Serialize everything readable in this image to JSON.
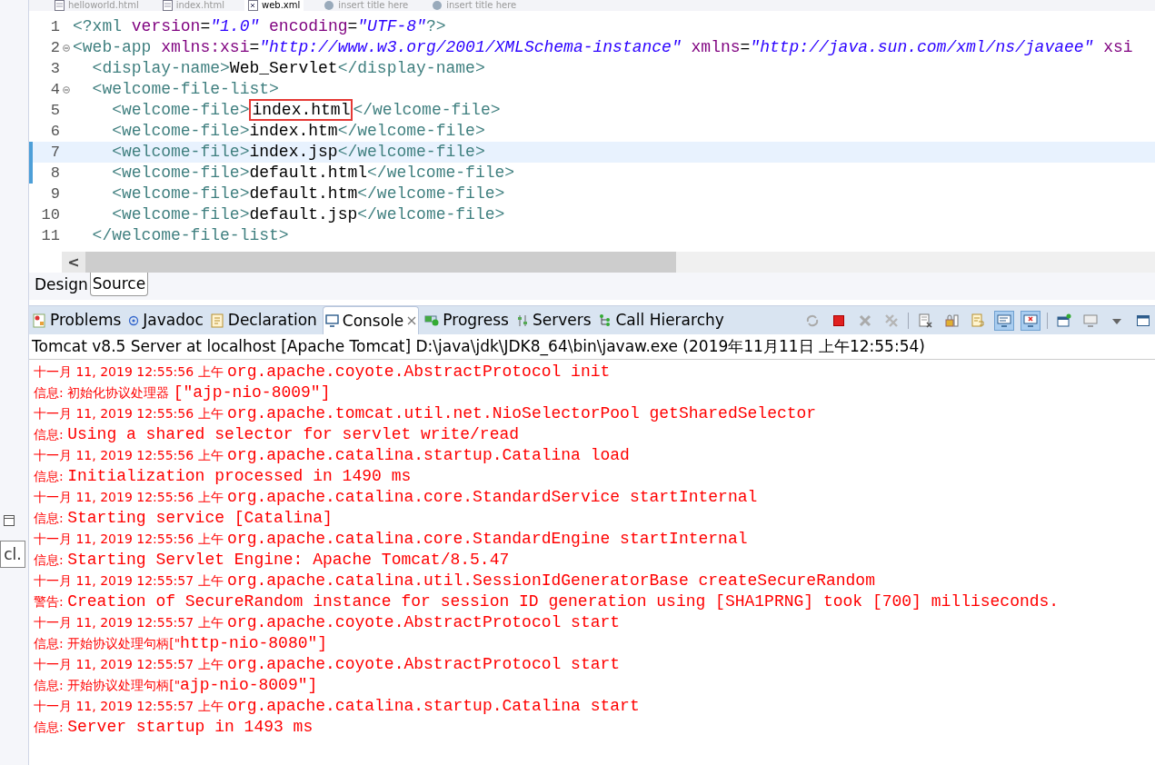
{
  "editor_tabs": [
    {
      "label": "helloworld.html",
      "selected": false,
      "kind": "html"
    },
    {
      "label": "index.html",
      "selected": false,
      "kind": "html"
    },
    {
      "label": "web.xml",
      "selected": true,
      "kind": "xml"
    },
    {
      "label": "insert title here",
      "selected": false,
      "kind": "web"
    },
    {
      "label": "insert title here",
      "selected": false,
      "kind": "web"
    }
  ],
  "code_lines": [
    {
      "number": "1",
      "foldable": false,
      "current": false,
      "changed": false,
      "tokens": [
        {
          "kind": "tag",
          "text": "<?xml "
        },
        {
          "kind": "attr",
          "text": "version"
        },
        {
          "kind": "punct",
          "text": "="
        },
        {
          "kind": "value",
          "text": "\"1.0\""
        },
        {
          "kind": "attr",
          "text": " encoding"
        },
        {
          "kind": "punct",
          "text": "="
        },
        {
          "kind": "value",
          "text": "\"UTF-8\""
        },
        {
          "kind": "tag",
          "text": "?>"
        }
      ]
    },
    {
      "number": "2",
      "foldable": true,
      "current": false,
      "changed": false,
      "tokens": [
        {
          "kind": "tag",
          "text": "<web-app "
        },
        {
          "kind": "attr",
          "text": "xmlns:xsi"
        },
        {
          "kind": "punct",
          "text": "="
        },
        {
          "kind": "value",
          "text": "\"http://www.w3.org/2001/XMLSchema-instance\""
        },
        {
          "kind": "attr",
          "text": " xmlns"
        },
        {
          "kind": "punct",
          "text": "="
        },
        {
          "kind": "value",
          "text": "\"http://java.sun.com/xml/ns/javaee\""
        },
        {
          "kind": "attr",
          "text": " xsi"
        }
      ]
    },
    {
      "number": "3",
      "foldable": false,
      "current": false,
      "changed": false,
      "tokens": [
        {
          "kind": "tag",
          "text": "  <display-name>"
        },
        {
          "kind": "text",
          "text": "Web_Servlet"
        },
        {
          "kind": "tag",
          "text": "</display-name>"
        }
      ]
    },
    {
      "number": "4",
      "foldable": true,
      "current": false,
      "changed": false,
      "tokens": [
        {
          "kind": "tag",
          "text": "  <welcome-file-list>"
        }
      ]
    },
    {
      "number": "5",
      "foldable": false,
      "current": false,
      "changed": false,
      "tokens": [
        {
          "kind": "tag",
          "text": "    <welcome-file>"
        },
        {
          "kind": "text",
          "text": "index.html",
          "boxed": true
        },
        {
          "kind": "tag",
          "text": "</welcome-file>"
        }
      ]
    },
    {
      "number": "6",
      "foldable": false,
      "current": false,
      "changed": false,
      "tokens": [
        {
          "kind": "tag",
          "text": "    <welcome-file>"
        },
        {
          "kind": "text",
          "text": "index.htm"
        },
        {
          "kind": "tag",
          "text": "</welcome-file>"
        }
      ]
    },
    {
      "number": "7",
      "foldable": false,
      "current": true,
      "changed": true,
      "tokens": [
        {
          "kind": "tag",
          "text": "    <welcome-file>"
        },
        {
          "kind": "text",
          "text": "index.jsp"
        },
        {
          "kind": "tag",
          "text": "</welcome-file>"
        }
      ]
    },
    {
      "number": "8",
      "foldable": false,
      "current": false,
      "changed": true,
      "tokens": [
        {
          "kind": "tag",
          "text": "    <welcome-file>"
        },
        {
          "kind": "text",
          "text": "default.html"
        },
        {
          "kind": "tag",
          "text": "</welcome-file>"
        }
      ]
    },
    {
      "number": "9",
      "foldable": false,
      "current": false,
      "changed": false,
      "tokens": [
        {
          "kind": "tag",
          "text": "    <welcome-file>"
        },
        {
          "kind": "text",
          "text": "default.htm"
        },
        {
          "kind": "tag",
          "text": "</welcome-file>"
        }
      ]
    },
    {
      "number": "10",
      "foldable": false,
      "current": false,
      "changed": false,
      "tokens": [
        {
          "kind": "tag",
          "text": "    <welcome-file>"
        },
        {
          "kind": "text",
          "text": "default.jsp"
        },
        {
          "kind": "tag",
          "text": "</welcome-file>"
        }
      ]
    },
    {
      "number": "11",
      "foldable": false,
      "current": false,
      "changed": false,
      "tokens": [
        {
          "kind": "tag",
          "text": "  </welcome-file-list>"
        }
      ]
    }
  ],
  "scroll_arrow": "<",
  "view_tabs": [
    {
      "label": "Design",
      "selected": false
    },
    {
      "label": "Source",
      "selected": true
    }
  ],
  "side_button": "cl.",
  "console_tabs": [
    {
      "label": "Problems",
      "kind": "problems",
      "selected": false
    },
    {
      "label": "Javadoc",
      "kind": "javadoc",
      "selected": false
    },
    {
      "label": "Declaration",
      "kind": "declaration",
      "selected": false
    },
    {
      "label": "Console",
      "kind": "console",
      "selected": true
    },
    {
      "label": "Progress",
      "kind": "progress",
      "selected": false
    },
    {
      "label": "Servers",
      "kind": "servers",
      "selected": false
    },
    {
      "label": "Call Hierarchy",
      "kind": "hierarchy",
      "selected": false
    }
  ],
  "toolbar": [
    {
      "kind": "relaunch",
      "pressed": false
    },
    {
      "kind": "stop",
      "pressed": false
    },
    {
      "kind": "remove",
      "pressed": false
    },
    {
      "kind": "remove-all",
      "pressed": false
    },
    {
      "kind": "separator"
    },
    {
      "kind": "clear",
      "pressed": false
    },
    {
      "kind": "scroll-lock",
      "pressed": false
    },
    {
      "kind": "word-wrap",
      "pressed": false
    },
    {
      "kind": "show-out",
      "pressed": true
    },
    {
      "kind": "show-err",
      "pressed": true
    },
    {
      "kind": "separator"
    },
    {
      "kind": "pin",
      "pressed": false
    },
    {
      "kind": "display",
      "pressed": false
    },
    {
      "kind": "menu",
      "pressed": false
    },
    {
      "kind": "maximize",
      "pressed": false
    }
  ],
  "console_header": "Tomcat v8.5 Server at localhost [Apache Tomcat] D:\\java\\jdk\\JDK8_64\\bin\\javaw.exe (2019年11月11日 上午12:55:54)",
  "log_lines": [
    {
      "segments": [
        {
          "kind": "sans",
          "text": "十一月 11, 2019 12:55:56 上午 "
        },
        {
          "kind": "mono",
          "text": "org.apache.coyote.AbstractProtocol init"
        }
      ]
    },
    {
      "segments": [
        {
          "kind": "sans",
          "text": "信息: 初始化协议处理器 "
        },
        {
          "kind": "mono",
          "text": "[\"ajp-nio-8009\"]"
        }
      ]
    },
    {
      "segments": [
        {
          "kind": "sans",
          "text": "十一月 11, 2019 12:55:56 上午 "
        },
        {
          "kind": "mono",
          "text": "org.apache.tomcat.util.net.NioSelectorPool getSharedSelector"
        }
      ]
    },
    {
      "segments": [
        {
          "kind": "sans",
          "text": "信息: "
        },
        {
          "kind": "mono",
          "text": "Using a shared selector for servlet write/read"
        }
      ]
    },
    {
      "segments": [
        {
          "kind": "sans",
          "text": "十一月 11, 2019 12:55:56 上午 "
        },
        {
          "kind": "mono",
          "text": "org.apache.catalina.startup.Catalina load"
        }
      ]
    },
    {
      "segments": [
        {
          "kind": "sans",
          "text": "信息: "
        },
        {
          "kind": "mono",
          "text": "Initialization processed in 1490 ms"
        }
      ]
    },
    {
      "segments": [
        {
          "kind": "sans",
          "text": "十一月 11, 2019 12:55:56 上午 "
        },
        {
          "kind": "mono",
          "text": "org.apache.catalina.core.StandardService startInternal"
        }
      ]
    },
    {
      "segments": [
        {
          "kind": "sans",
          "text": "信息: "
        },
        {
          "kind": "mono",
          "text": "Starting service [Catalina]"
        }
      ]
    },
    {
      "segments": [
        {
          "kind": "sans",
          "text": "十一月 11, 2019 12:55:56 上午 "
        },
        {
          "kind": "mono",
          "text": "org.apache.catalina.core.StandardEngine startInternal"
        }
      ]
    },
    {
      "segments": [
        {
          "kind": "sans",
          "text": "信息: "
        },
        {
          "kind": "mono",
          "text": "Starting Servlet Engine: Apache Tomcat/8.5.47"
        }
      ]
    },
    {
      "segments": [
        {
          "kind": "sans",
          "text": "十一月 11, 2019 12:55:57 上午 "
        },
        {
          "kind": "mono",
          "text": "org.apache.catalina.util.SessionIdGeneratorBase createSecureRandom"
        }
      ]
    },
    {
      "segments": [
        {
          "kind": "sans",
          "text": "警告: "
        },
        {
          "kind": "mono",
          "text": "Creation of SecureRandom instance for session ID generation using [SHA1PRNG] took [700] milliseconds."
        }
      ]
    },
    {
      "segments": [
        {
          "kind": "sans",
          "text": "十一月 11, 2019 12:55:57 上午 "
        },
        {
          "kind": "mono",
          "text": "org.apache.coyote.AbstractProtocol start"
        }
      ]
    },
    {
      "segments": [
        {
          "kind": "sans",
          "text": "信息: 开始协议处理句柄[\""
        },
        {
          "kind": "mono",
          "text": "http-nio-8080\"]"
        }
      ]
    },
    {
      "segments": [
        {
          "kind": "sans",
          "text": "十一月 11, 2019 12:55:57 上午 "
        },
        {
          "kind": "mono",
          "text": "org.apache.coyote.AbstractProtocol start"
        }
      ]
    },
    {
      "segments": [
        {
          "kind": "sans",
          "text": "信息: 开始协议处理句柄[\""
        },
        {
          "kind": "mono",
          "text": "ajp-nio-8009\"]"
        }
      ]
    },
    {
      "segments": [
        {
          "kind": "sans",
          "text": "十一月 11, 2019 12:55:57 上午 "
        },
        {
          "kind": "mono",
          "text": "org.apache.catalina.startup.Catalina start"
        }
      ]
    },
    {
      "segments": [
        {
          "kind": "sans",
          "text": "信息: "
        },
        {
          "kind": "mono",
          "text": "Server startup in 1493 ms"
        }
      ]
    }
  ]
}
